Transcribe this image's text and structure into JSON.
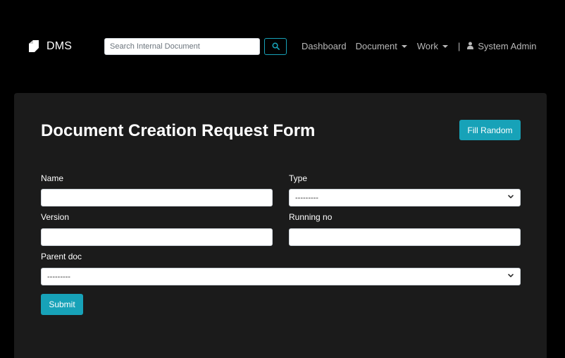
{
  "brand": {
    "name": "DMS",
    "logo_icon": "document-fold-icon"
  },
  "search": {
    "placeholder": "Search Internal Document",
    "value": "",
    "button_icon": "search-icon"
  },
  "nav": {
    "items": [
      {
        "label": "Dashboard",
        "dropdown": false
      },
      {
        "label": "Document",
        "dropdown": true
      },
      {
        "label": "Work",
        "dropdown": true
      }
    ],
    "separator": "|",
    "user": {
      "label": "System Admin",
      "icon": "user-icon"
    }
  },
  "form": {
    "title": "Document Creation Request Form",
    "fill_random_label": "Fill Random",
    "fields": {
      "name": {
        "label": "Name",
        "value": ""
      },
      "type": {
        "label": "Type",
        "selected": "---------"
      },
      "version": {
        "label": "Version",
        "value": ""
      },
      "running_no": {
        "label": "Running no",
        "value": ""
      },
      "parent_doc": {
        "label": "Parent doc",
        "selected": "---------"
      }
    },
    "submit_label": "Submit"
  },
  "colors": {
    "accent": "#17a2b8",
    "background": "#000000",
    "card": "#1b1b1b",
    "nav_text": "#b8b8b8"
  }
}
